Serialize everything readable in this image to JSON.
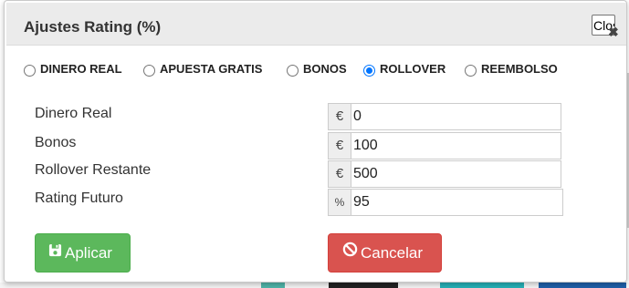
{
  "dialog": {
    "title": "Ajustes Rating (%)",
    "close_label": "Clos"
  },
  "radios": [
    {
      "label": "DINERO REAL",
      "checked": false
    },
    {
      "label": "APUESTA GRATIS",
      "checked": false
    },
    {
      "label": "BONOS",
      "checked": false
    },
    {
      "label": "ROLLOVER",
      "checked": true
    },
    {
      "label": "REEMBOLSO",
      "checked": false
    }
  ],
  "fields": [
    {
      "label": "Dinero Real",
      "unit": "€",
      "value": "0"
    },
    {
      "label": "Bonos",
      "unit": "€",
      "value": "100"
    },
    {
      "label": "Rollover Restante",
      "unit": "€",
      "value": "500"
    },
    {
      "label": "Rating Futuro",
      "unit": "%",
      "value": "95"
    }
  ],
  "buttons": {
    "apply_label": "Aplicar",
    "apply_icon": "save-icon",
    "cancel_label": "Cancelar",
    "cancel_icon": "ban-icon"
  },
  "colors": {
    "apply": "#5cb85c",
    "cancel": "#d9534f",
    "radio_checked": "#0075ff",
    "header_bg": "#ebebeb"
  }
}
